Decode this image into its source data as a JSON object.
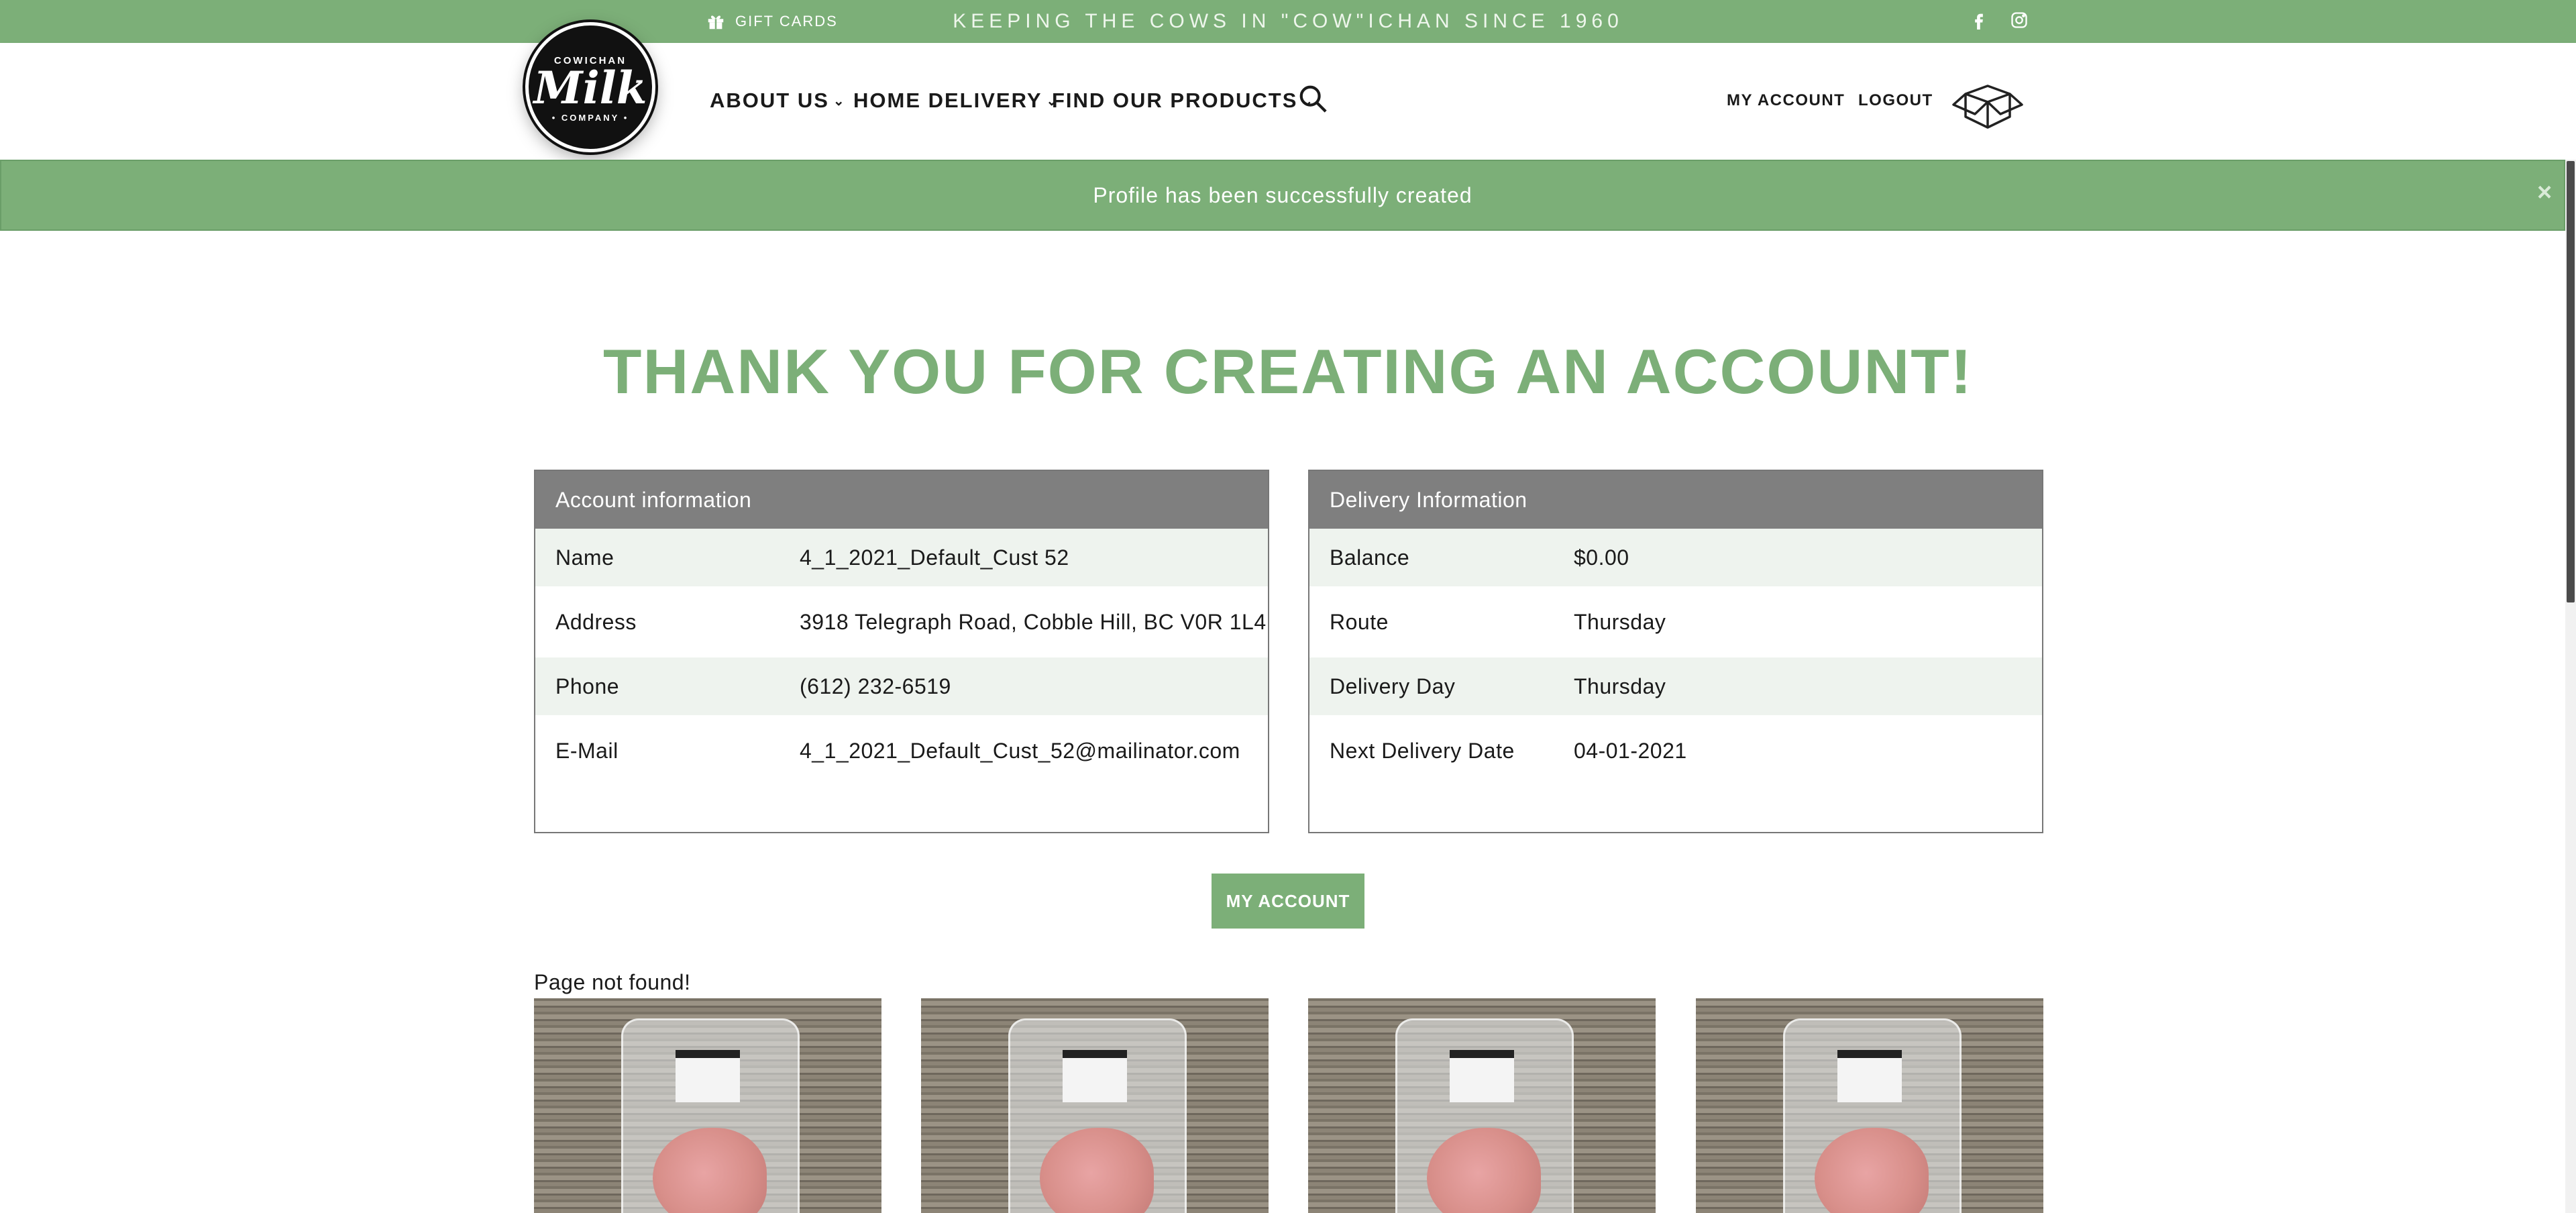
{
  "topbar": {
    "gift_cards": "GIFT CARDS",
    "tagline": "KEEPING THE COWS IN \"COW\"ICHAN SINCE 1960",
    "social": [
      "facebook-icon",
      "instagram-icon"
    ]
  },
  "logo": {
    "line1": "COWICHAN",
    "line2": "Milk",
    "line3": "• COMPANY •"
  },
  "nav": {
    "items": [
      "ABOUT US",
      "HOME DELIVERY",
      "FIND OUR PRODUCTS"
    ],
    "my_account": "MY ACCOUNT",
    "logout": "LOGOUT"
  },
  "alert": {
    "message": "Profile has been successfully created",
    "close": "×"
  },
  "title": "THANK YOU FOR CREATING AN ACCOUNT!",
  "account": {
    "heading": "Account information",
    "rows": [
      {
        "k": "Name",
        "v": "4_1_2021_Default_Cust 52"
      },
      {
        "k": "Address",
        "v": "3918 Telegraph Road, Cobble Hill, BC V0R 1L4"
      },
      {
        "k": "Phone",
        "v": "(612) 232-6519"
      },
      {
        "k": "E-Mail",
        "v": "4_1_2021_Default_Cust_52@mailinator.com"
      }
    ]
  },
  "delivery": {
    "heading": "Delivery Information",
    "rows": [
      {
        "k": "Balance",
        "v": "$0.00"
      },
      {
        "k": "Route",
        "v": "Thursday"
      },
      {
        "k": "Delivery Day",
        "v": "Thursday"
      },
      {
        "k": "Next Delivery Date",
        "v": "04-01-2021"
      }
    ]
  },
  "button": {
    "my_account": "MY ACCOUNT"
  },
  "not_found": "Page not found!",
  "colors": {
    "brand_green": "#7caf78",
    "table_header": "#7f7f7f",
    "row_shade": "#eef3ee"
  }
}
